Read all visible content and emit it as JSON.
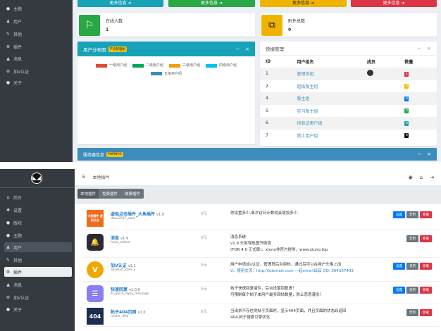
{
  "top": {
    "sidebar": [
      {
        "icon": "comment-icon",
        "label": "主题"
      },
      {
        "icon": "user-icon",
        "label": "用户"
      },
      {
        "icon": "wrench-icon",
        "label": "其他"
      },
      {
        "icon": "cogs-icon",
        "label": "插件"
      },
      {
        "icon": "bell-icon",
        "label": "消息"
      },
      {
        "icon": "cogs-icon",
        "label": "加V认证"
      },
      {
        "icon": "info-icon",
        "label": "关于"
      }
    ],
    "more_label": "更多信息",
    "more_colors": [
      "#17a2b8",
      "#28a745",
      "#f0b400",
      "#dc3545"
    ],
    "online": {
      "label": "在线人数",
      "value": "1"
    },
    "attach": {
      "label": "附件总数",
      "value": "0"
    },
    "chart": {
      "title": "用户分布图",
      "badge": "不含管理组",
      "legend": [
        {
          "label": "一级用户组",
          "color": "#dd4b39"
        },
        {
          "label": "二级用户组",
          "color": "#00a65a"
        },
        {
          "label": "三级用户组",
          "color": "#f39c12"
        },
        {
          "label": "四级用户组",
          "color": "#00c0ef"
        },
        {
          "label": "五级用户组",
          "color": "#3c8dbc"
        }
      ]
    },
    "quick": {
      "title": "快捷管理",
      "headers": [
        "ID",
        "用户组名",
        "成员",
        "数量"
      ],
      "rows": [
        {
          "id": "1",
          "name": "管理员组",
          "count": "1",
          "color": "#dc3545"
        },
        {
          "id": "2",
          "name": "超级版主组",
          "count": "0",
          "color": "#f0c000"
        },
        {
          "id": "4",
          "name": "版主组",
          "count": "0",
          "color": "#007bff"
        },
        {
          "id": "5",
          "name": "实习版主组",
          "count": "0",
          "color": "#28a745"
        },
        {
          "id": "6",
          "name": "待验证用户组",
          "count": "0",
          "color": "#17a2b8"
        },
        {
          "id": "7",
          "name": "禁止用户组",
          "count": "0",
          "color": "#111111"
        }
      ]
    },
    "server": {
      "title": "服务器信息",
      "badge": "PHPINFO"
    }
  },
  "bottom": {
    "sidebar": [
      {
        "icon": "home-icon",
        "label": "后台"
      },
      {
        "icon": "gear-icon",
        "label": "设置"
      },
      {
        "icon": "comment-icon",
        "label": "版块"
      },
      {
        "icon": "comment-icon",
        "label": "主题"
      },
      {
        "icon": "user-icon",
        "label": "用户"
      },
      {
        "icon": "wrench-icon",
        "label": "其他"
      },
      {
        "icon": "cogs-icon",
        "label": "插件"
      },
      {
        "icon": "bell-icon",
        "label": "消息"
      },
      {
        "icon": "cogs-icon",
        "label": "加V认证"
      },
      {
        "icon": "info-icon",
        "label": "关于"
      }
    ],
    "header_title": "本地插件",
    "tabs": [
      "本地插件",
      "免费插件",
      "收费插件"
    ],
    "buttons": {
      "set": "设置",
      "disable": "禁用",
      "uninstall": "卸载"
    },
    "plugins": [
      {
        "name": "虚拟点击插件_大鱼插件",
        "version": "v1.0",
        "id": "dayu2017_xuni",
        "price": "0元",
        "desc1": "你设置多少,单次访问计数就会增加多少.",
        "desc2": "",
        "desc3": "",
        "icon_text": "大鱼插件 虚拟点击",
        "set": true
      },
      {
        "name": "消息",
        "version": "v1.9",
        "id": "huux_notice",
        "price": "0元",
        "desc1": "消息系统",
        "desc2": "v1.9 头部导航图节微调",
        "desc3": "(FOR 4.0 正式版)，xiuno非官方提供，www.xiuno.top",
        "icon_text": "🔔",
        "set": false
      },
      {
        "name": "加V认证",
        "version": "v1.1",
        "id": "iqismart_com_v",
        "price": "0元",
        "desc1": "用户申请加v认证，管理员后台审核，通过后可以在用户头像上加",
        "desc2": "V。使用交流：http://iqismart.com 一起smart出品 QQ: 364337403",
        "desc3": "",
        "icon_text": "V",
        "set": true
      },
      {
        "name": "快速回复",
        "version": "v1.0.0",
        "id": "lh_quick_reply_message",
        "price": "0元",
        "desc1": "帖子快速回复插件，后台设置回复语！",
        "desc2": "可限制每个帖子单用户最多回帖数量，防止恶意灌水！",
        "desc3": "",
        "icon_text": "☰",
        "set": true
      },
      {
        "name": "帖子404页面",
        "version": "v1.0",
        "id": "nciaer_404",
        "price": "0元",
        "desc1": "当请求不存在的帖子页面时，显示404页面，并且页面的状态码返回",
        "desc2": "404,利于搜索引擎优化",
        "desc3": "",
        "icon_text": "404",
        "set": false
      }
    ]
  }
}
